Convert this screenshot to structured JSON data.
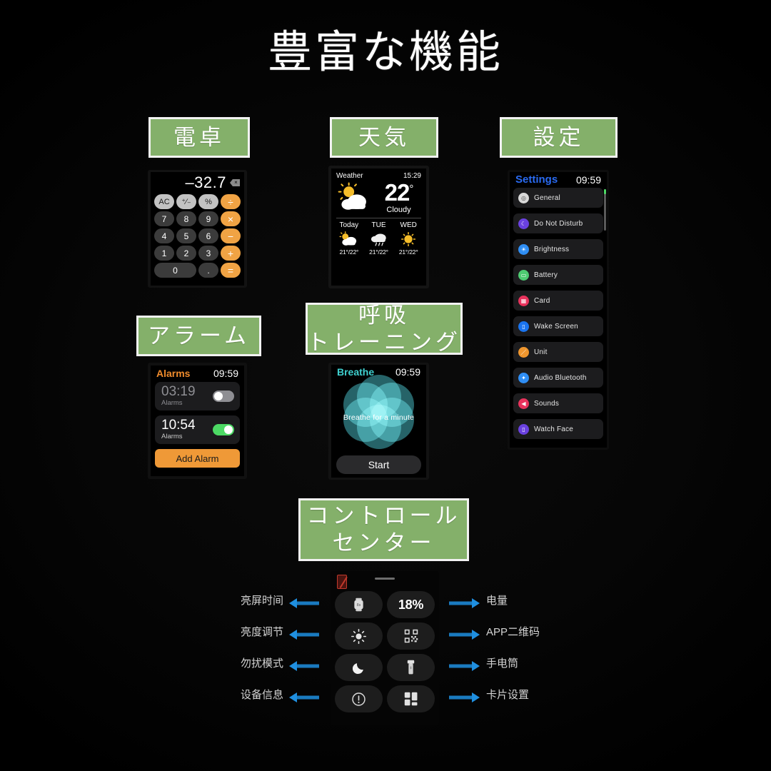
{
  "page": {
    "title": "豊富な機能",
    "accent_green": "#84b06a",
    "background": "#000000"
  },
  "plates": {
    "calculator": "電卓",
    "weather": "天気",
    "settings": "設定",
    "alarm": "アラーム",
    "breathe_line1": "呼吸",
    "breathe_line2": "トレーニング",
    "control_line1": "コントロール",
    "control_line2": "センター"
  },
  "calculator": {
    "display_value": "–32.7",
    "delete_icon": "backspace-icon",
    "keys": [
      {
        "label": "AC",
        "style": "light"
      },
      {
        "label": "⁺∕₋",
        "style": "light"
      },
      {
        "label": "%",
        "style": "light"
      },
      {
        "label": "÷",
        "style": "op"
      },
      {
        "label": "7",
        "style": "num"
      },
      {
        "label": "8",
        "style": "num"
      },
      {
        "label": "9",
        "style": "num"
      },
      {
        "label": "×",
        "style": "op"
      },
      {
        "label": "4",
        "style": "num"
      },
      {
        "label": "5",
        "style": "num"
      },
      {
        "label": "6",
        "style": "num"
      },
      {
        "label": "−",
        "style": "op"
      },
      {
        "label": "1",
        "style": "num"
      },
      {
        "label": "2",
        "style": "num"
      },
      {
        "label": "3",
        "style": "num"
      },
      {
        "label": "+",
        "style": "op"
      },
      {
        "label": "0",
        "style": "num wide"
      },
      {
        "label": ".",
        "style": "num"
      },
      {
        "label": "=",
        "style": "op"
      }
    ]
  },
  "weather": {
    "app_label": "Weather",
    "time": "15:29",
    "temperature": "22",
    "degree": "°",
    "condition": "Cloudy",
    "main_icon": "sun-behind-cloud-icon",
    "forecast": [
      {
        "day": "Today",
        "icon": "sun-behind-cloud-icon",
        "range": "21°/22°"
      },
      {
        "day": "TUE",
        "icon": "rain-cloud-icon",
        "range": "21°/22°"
      },
      {
        "day": "WED",
        "icon": "sun-icon",
        "range": "21°/22°"
      }
    ]
  },
  "settings": {
    "header_title": "Settings",
    "header_time": "09:59",
    "header_color": "#2a6bf2",
    "items": [
      {
        "label": "General",
        "icon": "gear-icon",
        "color": "#d8d8d8"
      },
      {
        "label": "Do Not Disturb",
        "icon": "moon-icon",
        "color": "#6a41e0"
      },
      {
        "label": "Brightness",
        "icon": "brightness-icon",
        "color": "#2f8ef4"
      },
      {
        "label": "Battery",
        "icon": "battery-icon",
        "color": "#4ec濃"
      },
      {
        "label": "Card",
        "icon": "card-icon",
        "color": "#e8325c"
      },
      {
        "label": "Wake Screen",
        "icon": "wake-screen-icon",
        "color": "#1a74ee"
      },
      {
        "label": "Unit",
        "icon": "unit-icon",
        "color": "#ef962e"
      },
      {
        "label": "Audio Bluetooth",
        "icon": "bluetooth-icon",
        "color": "#2f8ef4"
      },
      {
        "label": "Sounds",
        "icon": "speaker-icon",
        "color": "#e8325c"
      },
      {
        "label": "Watch Face",
        "icon": "watch-face-icon",
        "color": "#6a41e0"
      }
    ]
  },
  "alarms": {
    "header_title": "Alarms",
    "header_time": "09:59",
    "header_color": "#ef8b2c",
    "items": [
      {
        "time": "03:19",
        "sub": "Alarms",
        "enabled": false
      },
      {
        "time": "10:54",
        "sub": "Alarms",
        "enabled": true
      }
    ],
    "add_button": "Add Alarm"
  },
  "breathe": {
    "header_title": "Breathe",
    "header_time": "09:59",
    "header_color": "#3fd0cf",
    "center_text": "Breathe for a minute",
    "start_button": "Start"
  },
  "control_center": {
    "battery_icon": "battery-empty-icon",
    "handle_icon": "drag-handle-icon",
    "rows": [
      {
        "left_label": "亮屏时间",
        "left_icon": "watch-screen-time-icon",
        "right_label": "电量",
        "right_value": "18%",
        "right_icon": "battery-percent-icon"
      },
      {
        "left_label": "亮度调节",
        "left_icon": "brightness-sun-icon",
        "right_label": "APP二维码",
        "right_icon": "qr-code-icon"
      },
      {
        "left_label": "勿扰模式",
        "left_icon": "moon-icon",
        "right_label": "手电筒",
        "right_icon": "flashlight-icon"
      },
      {
        "left_label": "设备信息",
        "left_icon": "info-circle-icon",
        "right_label": "卡片设置",
        "right_icon": "cards-grid-icon"
      }
    ],
    "arrow_color": "#1f8fe0"
  }
}
